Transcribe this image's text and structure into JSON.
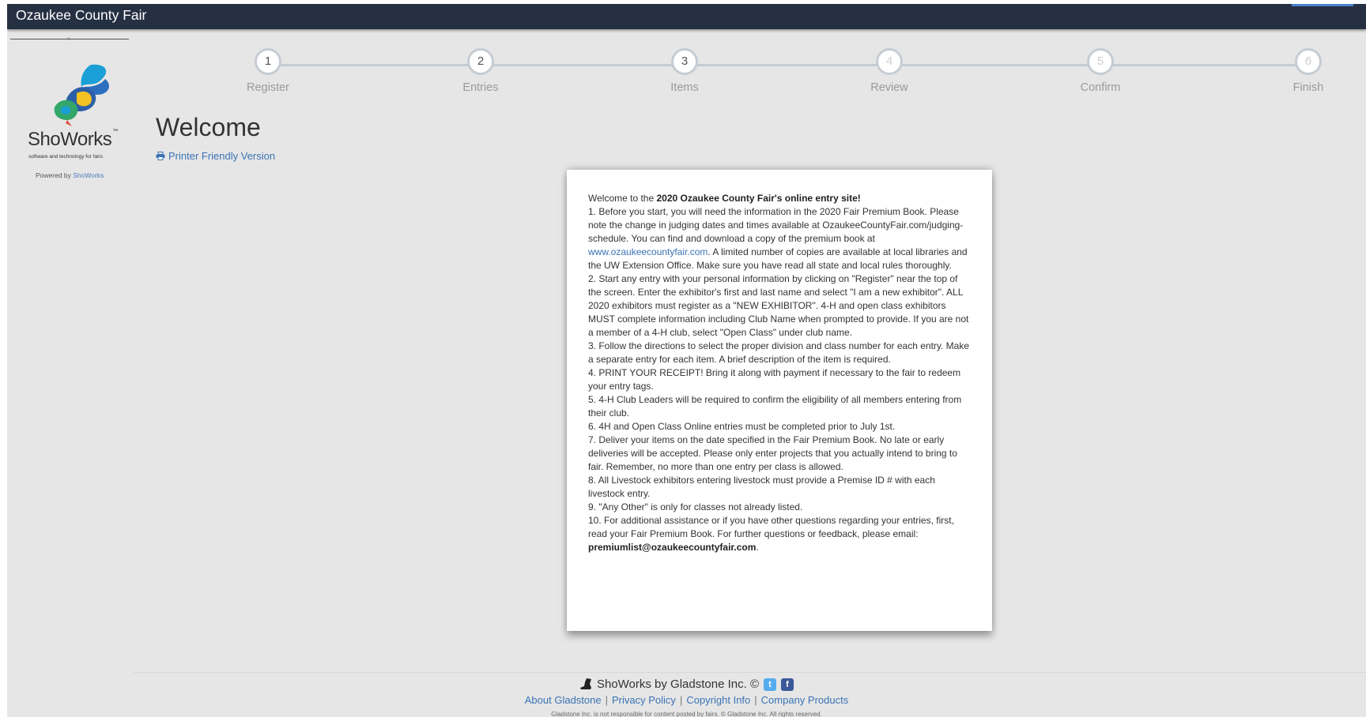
{
  "app": {
    "title": "Ozaukee County Fair"
  },
  "sidebar": {
    "brand": "ShoWorks",
    "trademark": "™",
    "tagline": "software and technology for fairs",
    "powered_prefix": "Powered by",
    "powered_link": "ShoWorks"
  },
  "stepper": {
    "current": 3,
    "steps": [
      {
        "number": "1",
        "label": "Register",
        "state": "complete"
      },
      {
        "number": "2",
        "label": "Entries",
        "state": "complete"
      },
      {
        "number": "3",
        "label": "Items",
        "state": "current"
      },
      {
        "number": "4",
        "label": "Review",
        "state": "upcoming"
      },
      {
        "number": "5",
        "label": "Confirm",
        "state": "upcoming"
      },
      {
        "number": "6",
        "label": "Finish",
        "state": "upcoming"
      }
    ]
  },
  "main": {
    "title": "Welcome",
    "printer_link": "Printer Friendly Version"
  },
  "welcome": {
    "intro_prefix": "Welcome to the ",
    "intro_bold": "2020 Ozaukee County Fair's online entry site!",
    "item1_a": "1. Before you start, you will need the information in the 2020 Fair Premium Book. Please note the change in judging dates and times available at OzaukeeCountyFair.com/judging-schedule. You can find and download a copy of the premium book at ",
    "item1_link": "www.ozaukeecountyfair.com",
    "item1_b": ". A limited number of copies are available at local libraries and the UW Extension Office. Make sure you have read all state and local rules thoroughly.",
    "item2": "2. Start any entry with your personal information by clicking on \"Register\" near the top of the screen. Enter the exhibitor's first and last name and select \"I am a new exhibitor\". ALL 2020 exhibitors must register as a \"NEW EXHIBITOR\". 4-H and open class exhibitors MUST complete information including Club Name when prompted to provide.  If you are not a member of a 4-H club, select \"Open Class\" under club name.",
    "item3": "3. Follow the directions to select the proper division and class number for each entry. Make a separate entry for each item. A brief description of the item is required.",
    "item4": "4. PRINT YOUR RECEIPT! Bring it along with payment if necessary to the fair to redeem your entry tags.",
    "item5": "5. 4-H Club Leaders will be required to confirm the eligibility of all members entering from their club.",
    "item6": "6. 4H and Open Class Online entries must be completed prior to July 1st.",
    "item7": "7. Deliver your items on the date specified in the Fair Premium Book. No late or early deliveries will be accepted. Please only enter projects that you actually intend to bring to fair. Remember, no more than one entry per class is allowed.",
    "item8": "8. All Livestock exhibitors entering livestock must provide a Premise ID # with each livestock entry.",
    "item9": "9. \"Any Other\" is only for classes not already listed.",
    "item10": "10. For additional assistance or if you have other questions regarding your entries, first, read your Fair Premium Book. For further questions or feedback, please email:",
    "email": "premiumlist@ozaukeecountyfair.com",
    "email_suffix": "."
  },
  "footer": {
    "company": "ShoWorks by Gladstone Inc. ©",
    "links": [
      "About Gladstone",
      "Privacy Policy",
      "Copyright Info",
      "Company Products"
    ],
    "separator": "|",
    "disclaimer": "Gladstone Inc. is not responsible for content posted by fairs. © Gladstone Inc. All rights reserved."
  },
  "icons": {
    "logo": "showorks-rabbit-logo",
    "printer": "printer-icon",
    "boot": "cowboy-boot-icon",
    "twitter": "twitter-icon",
    "facebook": "facebook-icon"
  },
  "colors": {
    "topbar": "#253043",
    "page_bg": "#e6e6e6",
    "link": "#3a73b5",
    "step_line": "#c6ccd4",
    "twitter": "#55acee",
    "facebook": "#3b5998"
  }
}
